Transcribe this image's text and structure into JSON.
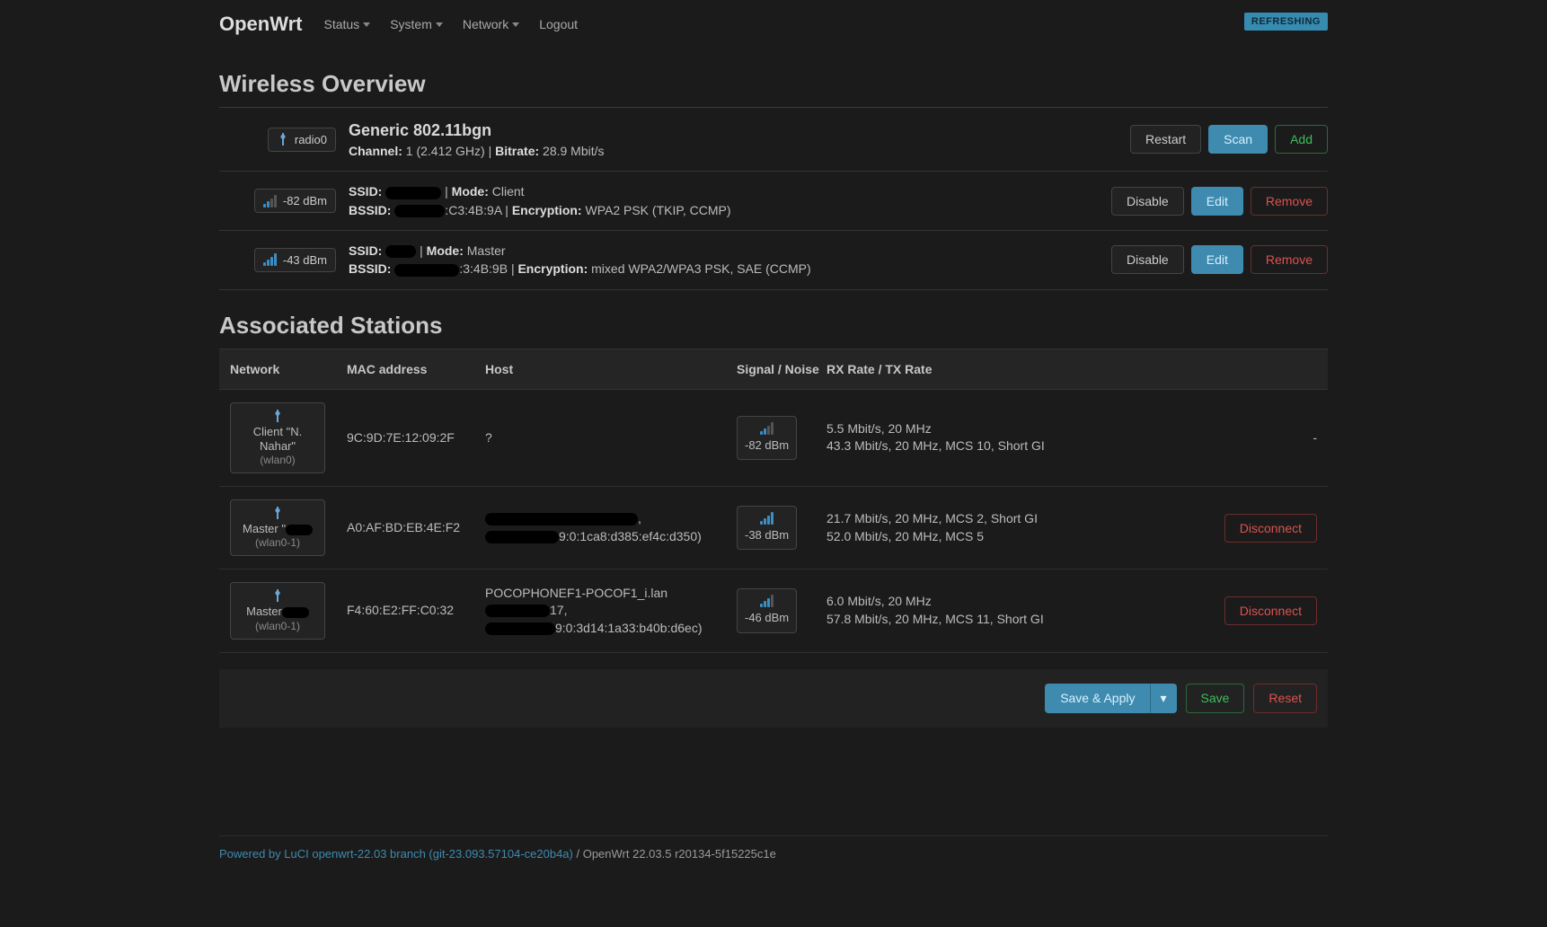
{
  "brand": "OpenWrt",
  "nav": {
    "status": "Status",
    "system": "System",
    "network": "Network",
    "logout": "Logout"
  },
  "refresh": "REFRESHING",
  "heading_overview": "Wireless Overview",
  "device": {
    "radio_name": "radio0",
    "title": "Generic 802.11bgn",
    "channel_label": "Channel:",
    "channel_val": "1 (2.412 GHz)",
    "pipe": " | ",
    "bitrate_label": "Bitrate:",
    "bitrate_val": "28.9 Mbit/s",
    "restart": "Restart",
    "scan": "Scan",
    "add": "Add"
  },
  "ifaces": [
    {
      "signal": "-82 dBm",
      "bars": 2,
      "ssid_label": "SSID:",
      "ssid_val": "",
      "mode_label": "Mode:",
      "mode_val": "Client",
      "bssid_label": "BSSID:",
      "bssid_suffix": ":C3:4B:9A",
      "enc_label": "Encryption:",
      "enc_val": "WPA2 PSK (TKIP, CCMP)",
      "disable": "Disable",
      "edit": "Edit",
      "remove": "Remove"
    },
    {
      "signal": "-43 dBm",
      "bars": 4,
      "ssid_label": "SSID:",
      "ssid_val": "",
      "mode_label": "Mode:",
      "mode_val": "Master",
      "bssid_label": "BSSID:",
      "bssid_suffix": ":3:4B:9B",
      "enc_label": "Encryption:",
      "enc_val": "mixed WPA2/WPA3 PSK, SAE (CCMP)",
      "disable": "Disable",
      "edit": "Edit",
      "remove": "Remove"
    }
  ],
  "heading_stations": "Associated Stations",
  "cols": {
    "network": "Network",
    "mac": "MAC address",
    "host": "Host",
    "signal": "Signal / Noise",
    "rate": "RX Rate / TX Rate"
  },
  "stations": [
    {
      "net_role": "Client \"N. Nahar\"",
      "iface": "(wlan0)",
      "mac": "9C:9D:7E:12:09:2F",
      "host": "?",
      "signal": "-82 dBm",
      "bars": 2,
      "rx": "5.5 Mbit/s, 20 MHz",
      "tx": "43.3 Mbit/s, 20 MHz, MCS 10, Short GI",
      "action": "-",
      "has_disconnect": false
    },
    {
      "net_role": "Master \"",
      "iface": "(wlan0-1)",
      "mac": "A0:AF:BD:EB:4E:F2",
      "host_suffix": "9:0:1ca8:d385:ef4c:d350)",
      "signal": "-38 dBm",
      "bars": 4,
      "rx": "21.7 Mbit/s, 20 MHz, MCS 2, Short GI",
      "tx": "52.0 Mbit/s, 20 MHz, MCS 5",
      "action": "Disconnect",
      "has_disconnect": true
    },
    {
      "net_role": "Master",
      "iface": "(wlan0-1)",
      "mac": "F4:60:E2:FF:C0:32",
      "host_line1": "POCOPHONEF1-POCOF1_i.lan",
      "host_line2_suffix": "17,",
      "host_line3_suffix": "9:0:3d14:1a33:b40b:d6ec)",
      "signal": "-46 dBm",
      "bars": 3,
      "rx": "6.0 Mbit/s, 20 MHz",
      "tx": "57.8 Mbit/s, 20 MHz, MCS 11, Short GI",
      "action": "Disconnect",
      "has_disconnect": true
    }
  ],
  "actions": {
    "save_apply": "Save & Apply",
    "drop": "▾",
    "save": "Save",
    "reset": "Reset"
  },
  "footer": {
    "link": "Powered by LuCI openwrt-22.03 branch (git-23.093.57104-ce20b4a)",
    "tail": " / OpenWrt 22.03.5 r20134-5f15225c1e"
  }
}
